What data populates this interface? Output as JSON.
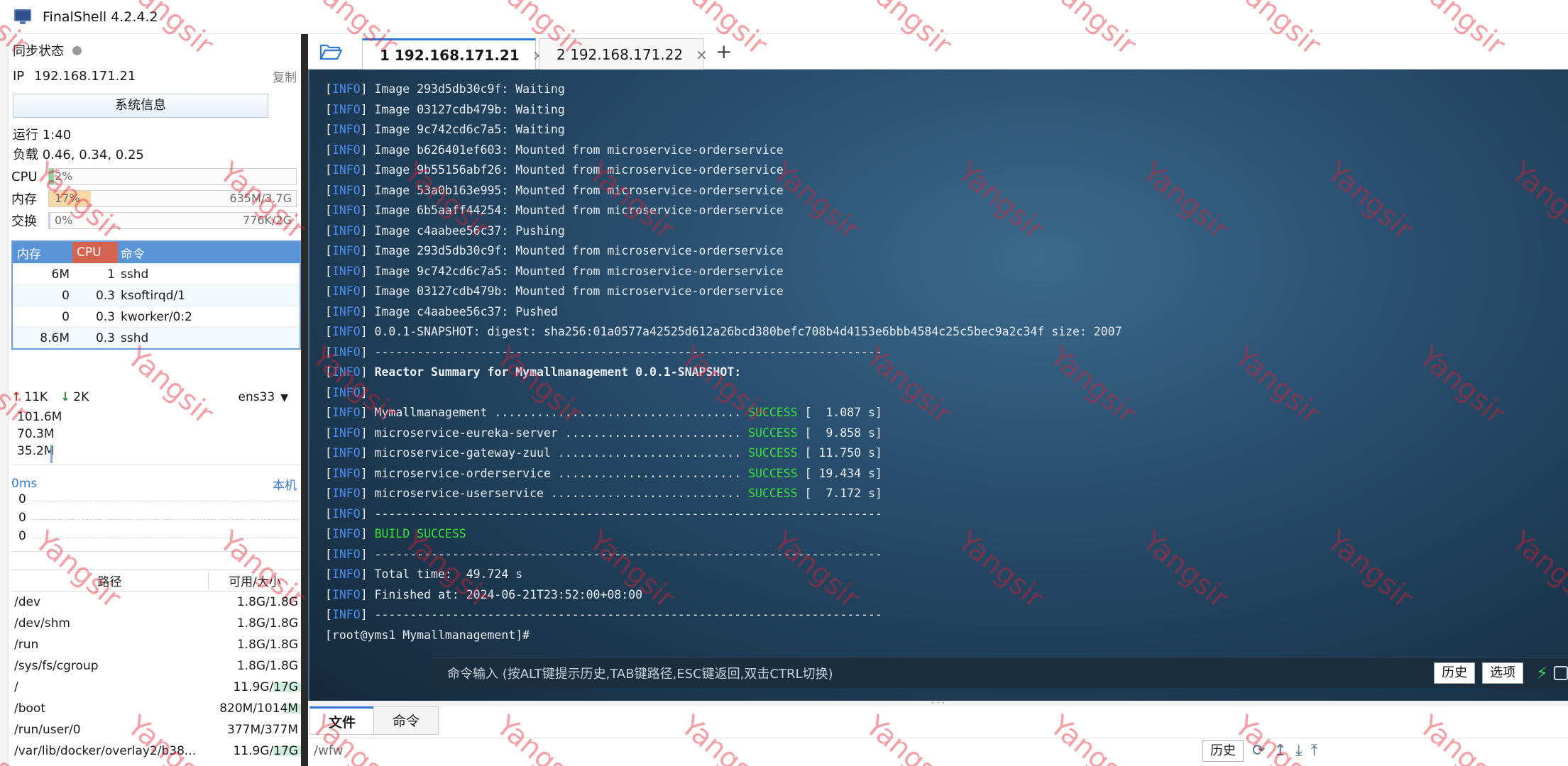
{
  "window": {
    "title": "FinalShell 4.2.4.2"
  },
  "left": {
    "sync_label": "同步状态",
    "ip_label": "IP",
    "ip_value": "192.168.171.21",
    "copy_label": "复制",
    "sysinfo_label": "系统信息",
    "uptime": "运行 1:40",
    "load": "负载 0.46, 0.34, 0.25",
    "cpu": {
      "label": "CPU",
      "percent": "2%",
      "fraction": 0.02
    },
    "mem": {
      "label": "内存",
      "percent": "17%",
      "amount": "635M/3.7G",
      "fraction": 0.17
    },
    "swap": {
      "label": "交换",
      "percent": "0%",
      "amount": "776K/2G",
      "fraction": 0.0
    },
    "proc_headers": [
      "内存",
      "CPU",
      "命令"
    ],
    "procs": [
      {
        "mem": "6M",
        "cpu": "1",
        "cmd": "sshd"
      },
      {
        "mem": "0",
        "cpu": "0.3",
        "cmd": "ksoftirqd/1"
      },
      {
        "mem": "0",
        "cpu": "0.3",
        "cmd": "kworker/0:2"
      },
      {
        "mem": "8.6M",
        "cpu": "0.3",
        "cmd": "sshd"
      }
    ],
    "net": {
      "up": "11K",
      "down": "2K",
      "iface": "ens33",
      "scale": [
        "101.6M",
        "70.3M",
        "35.2M"
      ]
    },
    "ping": {
      "ms": "0ms",
      "host": "本机",
      "values": [
        "0",
        "0",
        "0"
      ]
    },
    "disk_headers": [
      "路径",
      "可用/大小"
    ],
    "disks": [
      {
        "path": "/dev",
        "avail": "1.8G/1.8G",
        "used_fraction": 0.0
      },
      {
        "path": "/dev/shm",
        "avail": "1.8G/1.8G",
        "used_fraction": 0.0
      },
      {
        "path": "/run",
        "avail": "1.8G/1.8G",
        "used_fraction": 0.0
      },
      {
        "path": "/sys/fs/cgroup",
        "avail": "1.8G/1.8G",
        "used_fraction": 0.0
      },
      {
        "path": "/",
        "avail": "11.9G/17G",
        "used_fraction": 0.3
      },
      {
        "path": "/boot",
        "avail": "820M/1014M",
        "used_fraction": 0.19
      },
      {
        "path": "/run/user/0",
        "avail": "377M/377M",
        "used_fraction": 0.0
      },
      {
        "path": "/var/lib/docker/overlay2/b38...",
        "avail": "11.9G/17G",
        "used_fraction": 0.3
      }
    ]
  },
  "tabs": [
    {
      "num": "1",
      "host": "192.168.171.21",
      "close": "×"
    },
    {
      "num": "2",
      "host": "192.168.171.22",
      "close": "×"
    }
  ],
  "add_tab": "+",
  "terminal": {
    "lines": [
      [
        {
          "t": "["
        },
        {
          "t": "INFO",
          "c": "lvl"
        },
        {
          "t": "] Image 293d5db30c9f: Waiting"
        }
      ],
      [
        {
          "t": "["
        },
        {
          "t": "INFO",
          "c": "lvl"
        },
        {
          "t": "] Image 03127cdb479b: Waiting"
        }
      ],
      [
        {
          "t": "["
        },
        {
          "t": "INFO",
          "c": "lvl"
        },
        {
          "t": "] Image 9c742cd6c7a5: Waiting"
        }
      ],
      [
        {
          "t": "["
        },
        {
          "t": "INFO",
          "c": "lvl"
        },
        {
          "t": "] Image b626401ef603: Mounted from microservice-orderservice"
        }
      ],
      [
        {
          "t": "["
        },
        {
          "t": "INFO",
          "c": "lvl"
        },
        {
          "t": "] Image 9b55156abf26: Mounted from microservice-orderservice"
        }
      ],
      [
        {
          "t": "["
        },
        {
          "t": "INFO",
          "c": "lvl"
        },
        {
          "t": "] Image 53a0b163e995: Mounted from microservice-orderservice"
        }
      ],
      [
        {
          "t": "["
        },
        {
          "t": "INFO",
          "c": "lvl"
        },
        {
          "t": "] Image 6b5aaff44254: Mounted from microservice-orderservice"
        }
      ],
      [
        {
          "t": "["
        },
        {
          "t": "INFO",
          "c": "lvl"
        },
        {
          "t": "] Image c4aabee56c37: Pushing"
        }
      ],
      [
        {
          "t": "["
        },
        {
          "t": "INFO",
          "c": "lvl"
        },
        {
          "t": "] Image 293d5db30c9f: Mounted from microservice-orderservice"
        }
      ],
      [
        {
          "t": "["
        },
        {
          "t": "INFO",
          "c": "lvl"
        },
        {
          "t": "] Image 9c742cd6c7a5: Mounted from microservice-orderservice"
        }
      ],
      [
        {
          "t": "["
        },
        {
          "t": "INFO",
          "c": "lvl"
        },
        {
          "t": "] Image 03127cdb479b: Mounted from microservice-orderservice"
        }
      ],
      [
        {
          "t": "["
        },
        {
          "t": "INFO",
          "c": "lvl"
        },
        {
          "t": "] Image c4aabee56c37: Pushed"
        }
      ],
      [
        {
          "t": "["
        },
        {
          "t": "INFO",
          "c": "lvl"
        },
        {
          "t": "] 0.0.1-SNAPSHOT: digest: sha256:01a0577a42525d612a26bcd380befc708b4d4153e6bbb4584c25c5bec9a2c34f size: 2007"
        }
      ],
      [
        {
          "t": "["
        },
        {
          "t": "INFO",
          "c": "lvl"
        },
        {
          "t": "] ------------------------------------------------------------------------"
        }
      ],
      [
        {
          "t": "["
        },
        {
          "t": "INFO",
          "c": "lvl"
        },
        {
          "t": "] "
        },
        {
          "t": "Reactor Summary for Mymallmanagement 0.0.1-SNAPSHOT:",
          "c": "bold"
        }
      ],
      [
        {
          "t": "["
        },
        {
          "t": "INFO",
          "c": "lvl"
        },
        {
          "t": "]"
        }
      ],
      [
        {
          "t": "["
        },
        {
          "t": "INFO",
          "c": "lvl"
        },
        {
          "t": "] Mymallmanagement ................................... "
        },
        {
          "t": "SUCCESS",
          "c": "succ"
        },
        {
          "t": " [  1.087 s]"
        }
      ],
      [
        {
          "t": "["
        },
        {
          "t": "INFO",
          "c": "lvl"
        },
        {
          "t": "] microservice-eureka-server ......................... "
        },
        {
          "t": "SUCCESS",
          "c": "succ"
        },
        {
          "t": " [  9.858 s]"
        }
      ],
      [
        {
          "t": "["
        },
        {
          "t": "INFO",
          "c": "lvl"
        },
        {
          "t": "] microservice-gateway-zuul .......................... "
        },
        {
          "t": "SUCCESS",
          "c": "succ"
        },
        {
          "t": " [ 11.750 s]"
        }
      ],
      [
        {
          "t": "["
        },
        {
          "t": "INFO",
          "c": "lvl"
        },
        {
          "t": "] microservice-orderservice .......................... "
        },
        {
          "t": "SUCCESS",
          "c": "succ"
        },
        {
          "t": " [ 19.434 s]"
        }
      ],
      [
        {
          "t": "["
        },
        {
          "t": "INFO",
          "c": "lvl"
        },
        {
          "t": "] microservice-userservice ........................... "
        },
        {
          "t": "SUCCESS",
          "c": "succ"
        },
        {
          "t": " [  7.172 s]"
        }
      ],
      [
        {
          "t": "["
        },
        {
          "t": "INFO",
          "c": "lvl"
        },
        {
          "t": "] ------------------------------------------------------------------------"
        }
      ],
      [
        {
          "t": "["
        },
        {
          "t": "INFO",
          "c": "lvl"
        },
        {
          "t": "] "
        },
        {
          "t": "BUILD SUCCESS",
          "c": "succ"
        }
      ],
      [
        {
          "t": "["
        },
        {
          "t": "INFO",
          "c": "lvl"
        },
        {
          "t": "] ------------------------------------------------------------------------"
        }
      ],
      [
        {
          "t": "["
        },
        {
          "t": "INFO",
          "c": "lvl"
        },
        {
          "t": "] Total time:  49.724 s"
        }
      ],
      [
        {
          "t": "["
        },
        {
          "t": "INFO",
          "c": "lvl"
        },
        {
          "t": "] Finished at: 2024-06-21T23:52:00+08:00"
        }
      ],
      [
        {
          "t": "["
        },
        {
          "t": "INFO",
          "c": "lvl"
        },
        {
          "t": "] ------------------------------------------------------------------------"
        }
      ],
      [
        {
          "t": "[root@yms1 Mymallmanagement]# "
        }
      ]
    ]
  },
  "cmd_bar": {
    "placeholder": "命令输入 (按ALT键提示历史,TAB键路径,ESC键返回,双击CTRL切换)",
    "history": "历史",
    "options": "选项"
  },
  "bottom": {
    "tab_files": "文件",
    "tab_cmds": "命令",
    "path": "/wfw",
    "history": "历史"
  },
  "watermark": "Yangsir",
  "colors": {
    "accent": "#2f7ad8",
    "success": "#3be03b",
    "info": "#4d8cf0",
    "cpu_header": "#d4634f",
    "watermark": "#e11e32"
  }
}
